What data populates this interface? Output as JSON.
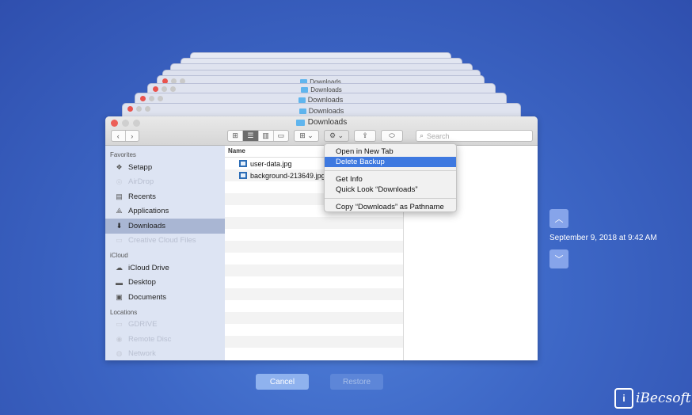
{
  "stack": {
    "title": "Downloads"
  },
  "window": {
    "title": "Downloads",
    "search_placeholder": "Search"
  },
  "sidebar": {
    "favorites_header": "Favorites",
    "favorites": [
      {
        "label": "Setapp",
        "icon": "setapp-icon",
        "dim": false
      },
      {
        "label": "AirDrop",
        "icon": "airdrop-icon",
        "dim": true
      },
      {
        "label": "Recents",
        "icon": "recents-icon",
        "dim": false
      },
      {
        "label": "Applications",
        "icon": "applications-icon",
        "dim": false
      },
      {
        "label": "Downloads",
        "icon": "downloads-icon",
        "dim": false,
        "selected": true
      },
      {
        "label": "Creative Cloud Files",
        "icon": "folder-icon",
        "dim": true
      }
    ],
    "icloud_header": "iCloud",
    "icloud": [
      {
        "label": "iCloud Drive",
        "icon": "cloud-icon"
      },
      {
        "label": "Desktop",
        "icon": "desktop-icon"
      },
      {
        "label": "Documents",
        "icon": "documents-icon"
      }
    ],
    "locations_header": "Locations",
    "locations": [
      {
        "label": "GDRIVE",
        "icon": "drive-icon"
      },
      {
        "label": "Remote Disc",
        "icon": "disc-icon"
      },
      {
        "label": "Network",
        "icon": "network-icon"
      }
    ]
  },
  "list": {
    "column_name": "Name",
    "files": [
      "user-data.jpg",
      "background-213649.jpg"
    ]
  },
  "context_menu": {
    "items": [
      "Open in New Tab",
      "Delete Backup"
    ],
    "items2": [
      "Get Info",
      "Quick Look “Downloads”"
    ],
    "items3": [
      "Copy “Downloads” as Pathname"
    ],
    "highlighted": "Delete Backup"
  },
  "timemachine": {
    "timestamp": "September 9, 2018 at 9:42 AM",
    "cancel_label": "Cancel",
    "restore_label": "Restore"
  },
  "brand": {
    "logo_text": "iBecsoft",
    "logo_letter": "i"
  },
  "colors": {
    "accent": "#3e79e0",
    "background": "#3d67c6"
  }
}
